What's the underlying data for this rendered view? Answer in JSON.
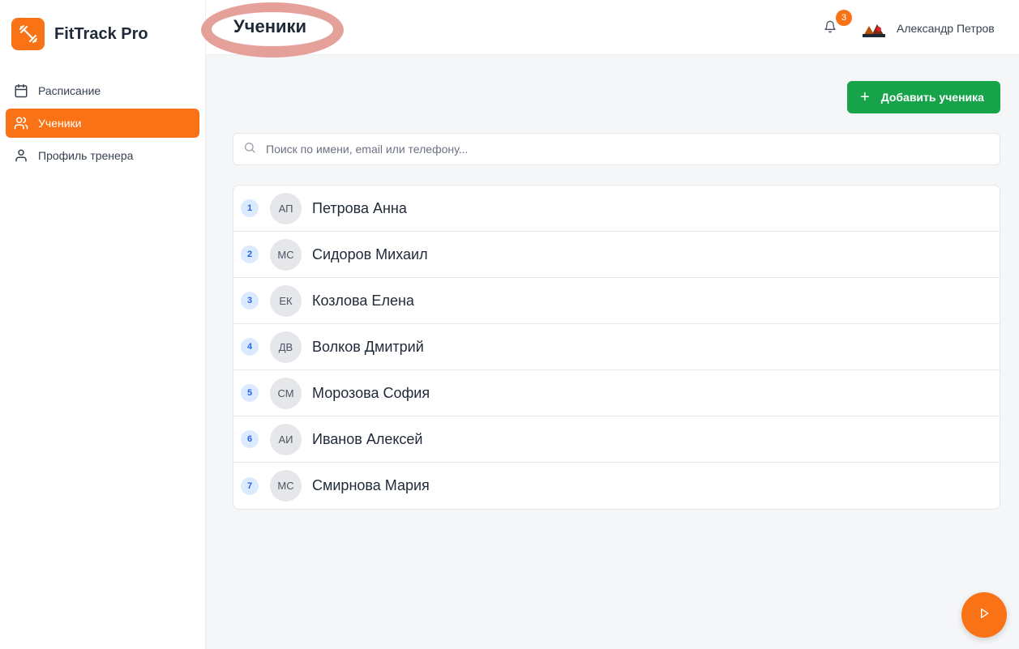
{
  "app": {
    "name": "FitTrack Pro",
    "accent": "#f97316"
  },
  "sidebar": {
    "items": [
      {
        "label": "Расписание",
        "icon": "calendar-icon",
        "active": false
      },
      {
        "label": "Ученики",
        "icon": "users-icon",
        "active": true
      },
      {
        "label": "Профиль тренера",
        "icon": "user-icon",
        "active": false
      }
    ]
  },
  "header": {
    "title": "Ученики",
    "notifications_count": "3",
    "user_name": "Александр Петров"
  },
  "actions": {
    "add_student_label": "Добавить ученика",
    "add_color": "#16a34a"
  },
  "search": {
    "placeholder": "Поиск по имени, email или телефону..."
  },
  "students": [
    {
      "index": "1",
      "initials": "АП",
      "name": "Петрова Анна"
    },
    {
      "index": "2",
      "initials": "МС",
      "name": "Сидоров Михаил"
    },
    {
      "index": "3",
      "initials": "ЕК",
      "name": "Козлова Елена"
    },
    {
      "index": "4",
      "initials": "ДВ",
      "name": "Волков Дмитрий"
    },
    {
      "index": "5",
      "initials": "СМ",
      "name": "Морозова София"
    },
    {
      "index": "6",
      "initials": "АИ",
      "name": "Иванов Алексей"
    },
    {
      "index": "7",
      "initials": "МС",
      "name": "Смирнова Мария"
    }
  ]
}
